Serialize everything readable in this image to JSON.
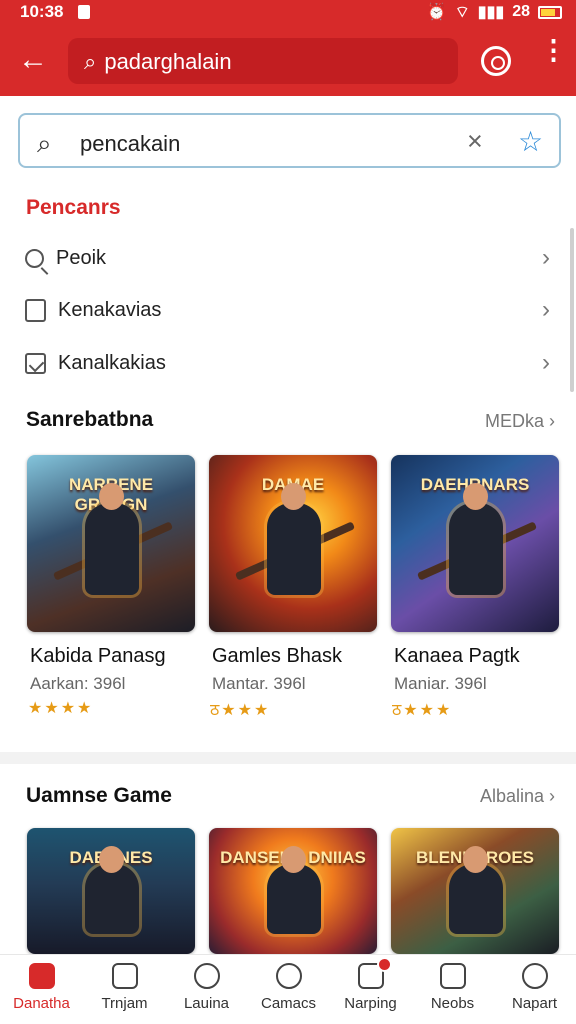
{
  "status": {
    "time": "10:38",
    "battery": "28"
  },
  "app": {
    "search_text": "padarghalain"
  },
  "search": {
    "query": "pencakain"
  },
  "sections": {
    "categories_title": "Pencanrs",
    "featured_title": "Sanrebatbna",
    "featured_link": "MEDka",
    "game_title": "Uamnse Game",
    "game_link": "Albalina"
  },
  "menu": [
    {
      "label": "Peoik"
    },
    {
      "label": "Kenakavias"
    },
    {
      "label": "Kanalkakias"
    }
  ],
  "cards": [
    {
      "name": "Kabida Panasg",
      "subtitle": "Aarkan: 396l",
      "art_title": "NARRENE GRELGN",
      "stars": "★★★★"
    },
    {
      "name": "Gamles Bhask",
      "subtitle": "Mantar. 396l",
      "art_title": "DAMAE",
      "stars": "ठ★★★"
    },
    {
      "name": "Kanaea Pagtk",
      "subtitle": "Maniar. 396l",
      "art_title": "DAEHRNARS",
      "stars": "ठ★★★"
    }
  ],
  "games": [
    {
      "art_title": "DAENNES"
    },
    {
      "art_title": "DANSEHA DNIIAS"
    },
    {
      "art_title": "BLENDEROES"
    }
  ],
  "bottom_nav": [
    {
      "label": "Danatha"
    },
    {
      "label": "Trnjam"
    },
    {
      "label": "Lauina"
    },
    {
      "label": "Camacs"
    },
    {
      "label": "Narping"
    },
    {
      "label": "Neobs"
    },
    {
      "label": "Napart"
    }
  ]
}
